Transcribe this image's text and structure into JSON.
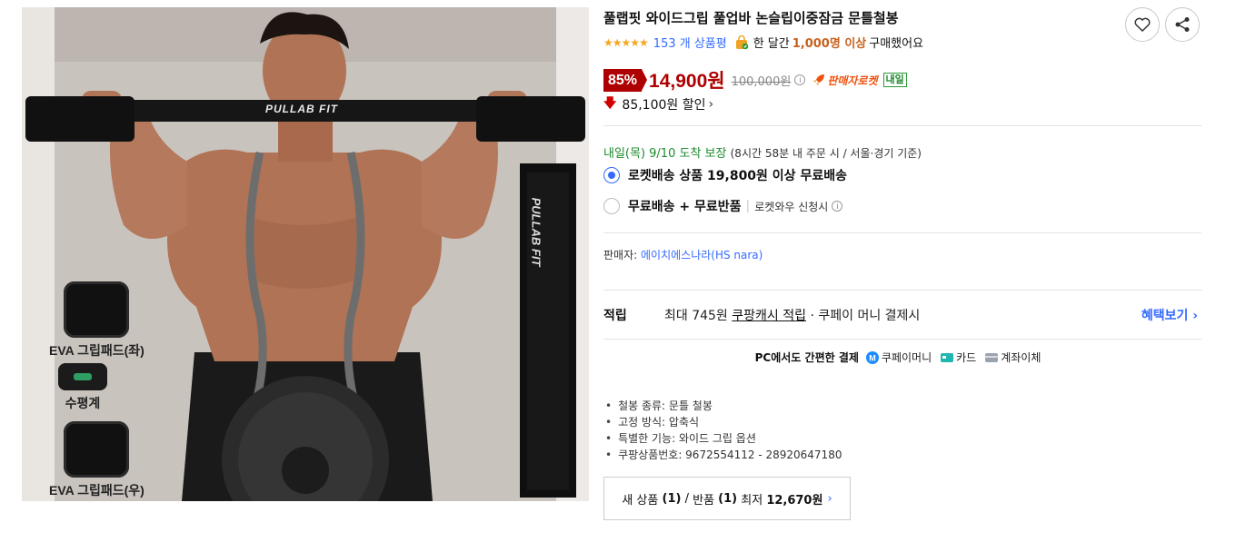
{
  "product": {
    "title": "풀랩핏 와이드그립 풀업바 논슬립이중잠금 문틀철봉",
    "rating": 5,
    "stars_text": "★★★★★",
    "review_count_text": "153 개 상품평",
    "sold_prefix": "한 달간",
    "sold_count": "1,000명 이상",
    "sold_suffix": "구매했어요"
  },
  "image": {
    "brand_on_bar": "PULLAB FIT",
    "box_brand": "PULLAB FIT",
    "accessories": [
      {
        "label": "EVA 그립패드(좌)"
      },
      {
        "label": "수평계"
      },
      {
        "label": "EVA 그립패드(우)"
      }
    ]
  },
  "price": {
    "discount_rate": "85%",
    "sale_price": "14,900원",
    "original_price": "100,000원",
    "info_symbol": "i",
    "rocket_label": "판매자로켓",
    "tomorrow_badge": "내일",
    "discount_amount_text": "85,100원 할인",
    "discount_chevron": "›"
  },
  "delivery": {
    "arrival_prefix": "내일(목) 9/10",
    "arrival_suffix": "도착 보장",
    "arrival_note": "(8시간 58분 내 주문 시 / 서울·경기 기준)",
    "options": [
      {
        "label": "로켓배송 상품 19,800원 이상 무료배송",
        "selected": true
      },
      {
        "label": "무료배송 + 무료반품",
        "note": "로켓와우 신청시",
        "selected": false
      }
    ],
    "sep": "|",
    "info_symbol": "i"
  },
  "seller": {
    "label": "판매자:",
    "name": "에이치에스나라(HS nara)"
  },
  "points": {
    "label": "적립",
    "prefix": "최대 745원",
    "cash_link": "쿠팡캐시 적립",
    "suffix": "· 쿠페이 머니 결제시",
    "benefit_link": "혜택보기 ›"
  },
  "payment": {
    "title": "PC에서도 간편한 결제",
    "methods": [
      {
        "label": "쿠페이머니",
        "icon": "coupay-icon"
      },
      {
        "label": "카드",
        "icon": "card-icon"
      },
      {
        "label": "계좌이체",
        "icon": "bank-icon"
      }
    ]
  },
  "attributes": [
    "철봉 종류: 문틀 철봉",
    "고정 방식: 압축식",
    "특별한 기능: 와이드 그립 옵션",
    "쿠팡상품번호: 9672554112 - 28920647180"
  ],
  "other_sellers": {
    "text_a": "새 상품",
    "count_a": "(1)",
    "sep": "/",
    "text_b": "반품",
    "count_b": "(1)",
    "min_label": "최저",
    "min_price": "12,670원",
    "chevron": "›"
  },
  "colors": {
    "accent_blue": "#346aff",
    "price_red": "#ae0000",
    "rocket_orange": "#f0520d",
    "delivery_green": "#1d8b2c",
    "star": "#f5a623"
  }
}
